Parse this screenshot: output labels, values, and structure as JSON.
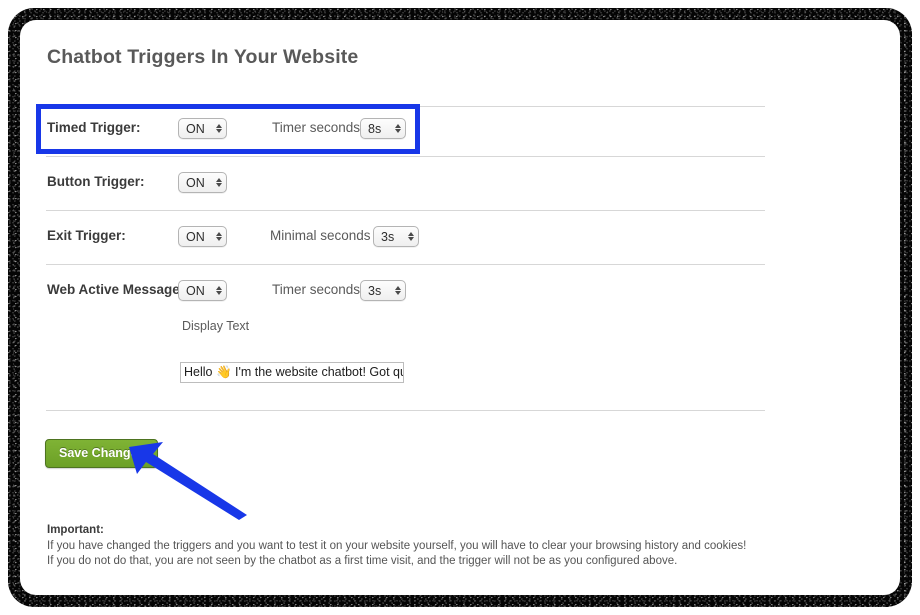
{
  "page": {
    "title": "Chatbot Triggers In Your Website"
  },
  "rows": [
    {
      "label": "Timed Trigger:",
      "toggle_value": "ON",
      "seconds_label": "Timer seconds",
      "seconds_value": "8s",
      "highlighted": true
    },
    {
      "label": "Button Trigger:",
      "toggle_value": "ON",
      "seconds_label": "",
      "seconds_value": "",
      "highlighted": false
    },
    {
      "label": "Exit Trigger:",
      "toggle_value": "ON",
      "seconds_label": "Minimal seconds",
      "seconds_value": "3s",
      "highlighted": false
    },
    {
      "label": "Web Active Message:",
      "toggle_value": "ON",
      "seconds_label": "Timer seconds",
      "seconds_value": "3s",
      "highlighted": false
    }
  ],
  "display_text": {
    "label": "Display Text",
    "value": "Hello 👋 I'm the website chatbot! Got questions?"
  },
  "actions": {
    "save_label": "Save Changes"
  },
  "footer": {
    "important_label": "Important:",
    "line1": "If you have changed the triggers and you want to test it on your website yourself, you will have to clear your browsing history and cookies!",
    "line2": "If you do not do that, you are not seen by the chatbot as a first time visit, and the trigger will not be as you configured above."
  },
  "colors": {
    "highlight_blue": "#1837e8",
    "arrow_blue": "#1837e8",
    "save_green": "#6ca026",
    "title_gray": "#595959",
    "divider_gray": "#d7d7d7"
  },
  "icons": {
    "stepper": "stepper-arrows-icon",
    "pointer": "pointer-arrow-icon"
  }
}
